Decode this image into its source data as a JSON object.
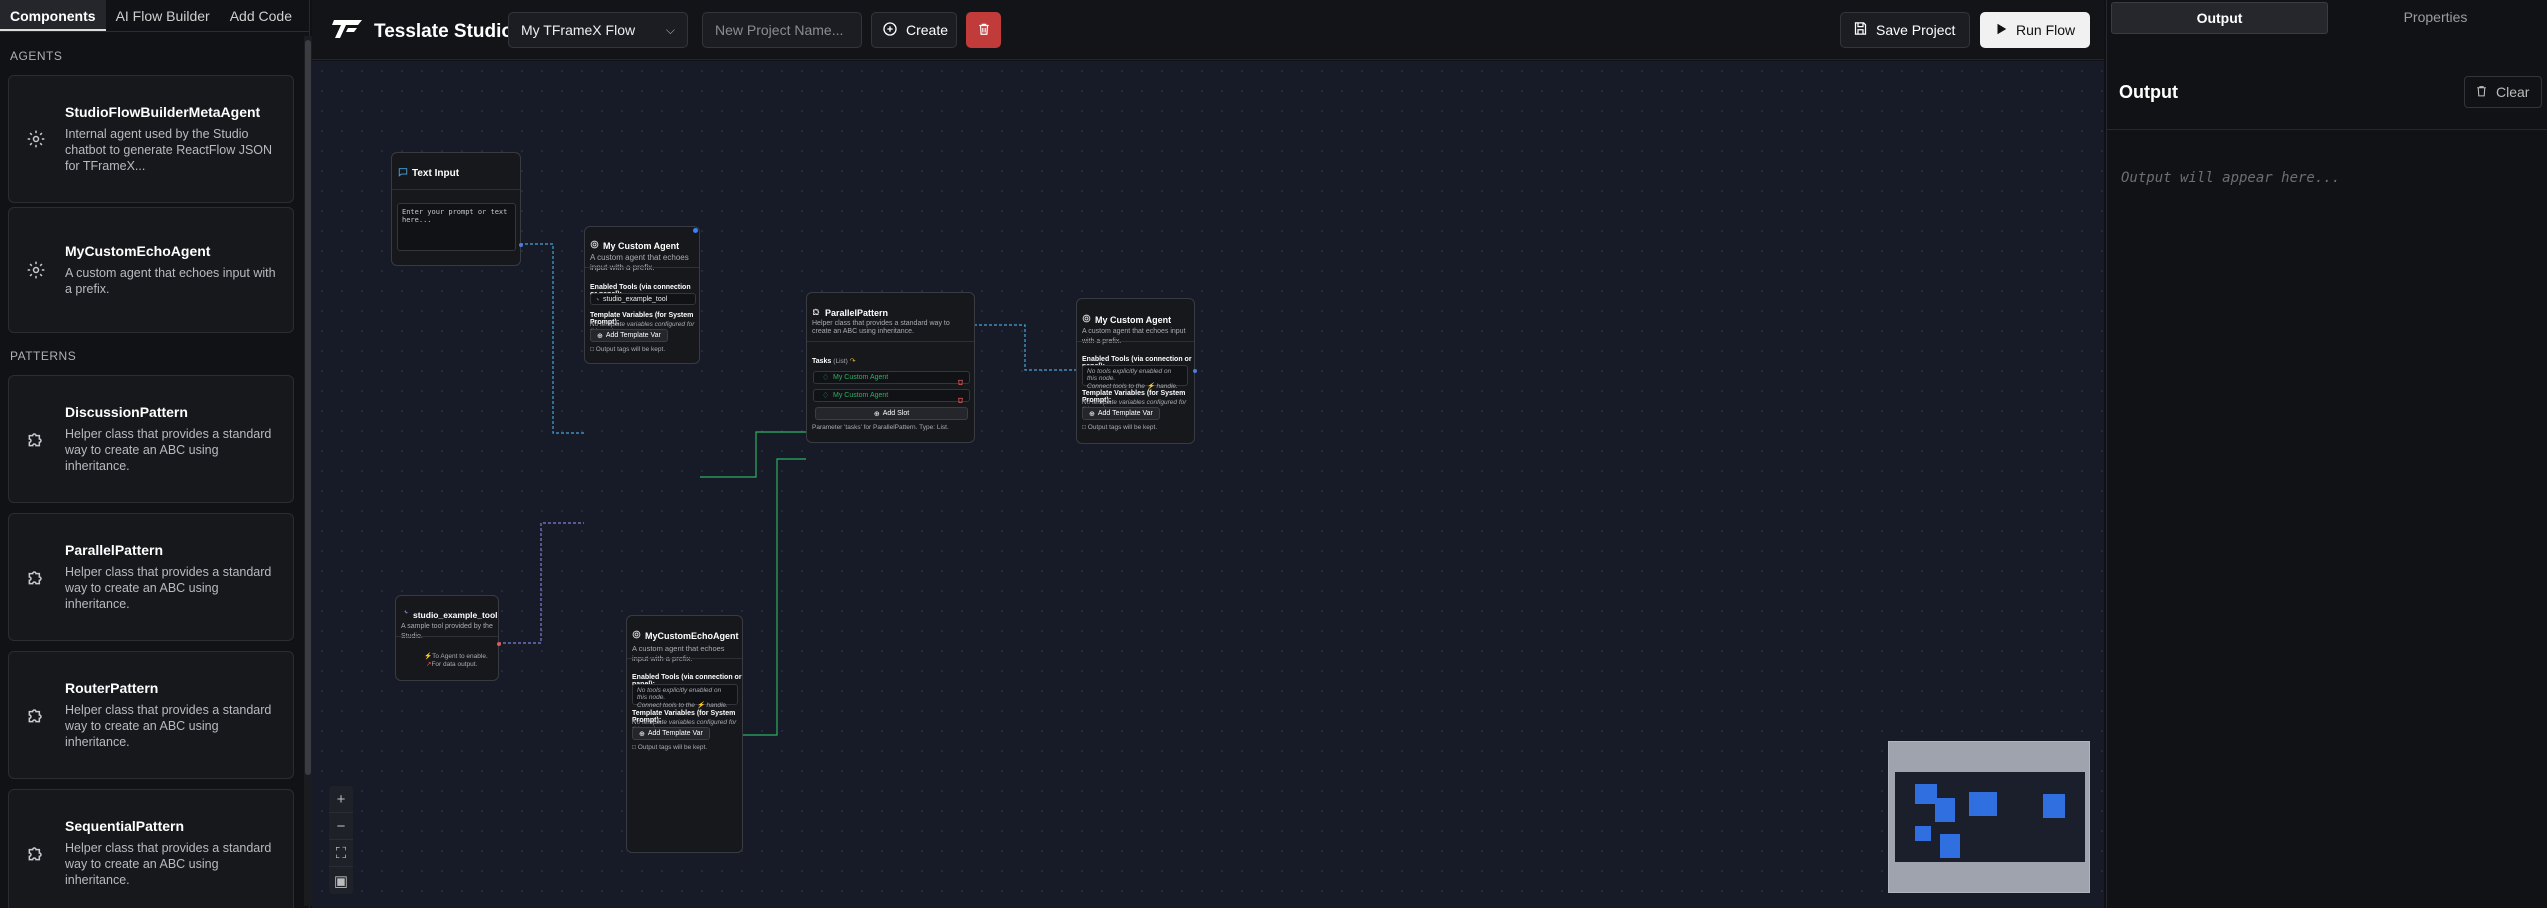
{
  "sidebar": {
    "tabs": [
      "Components",
      "AI Flow Builder",
      "Add Code"
    ],
    "sections": {
      "agents": "AGENTS",
      "patterns": "PATTERNS"
    },
    "agents": [
      {
        "title": "StudioFlowBuilderMetaAgent",
        "desc": "Internal agent used by the Studio chatbot to generate ReactFlow JSON for TFrameX..."
      },
      {
        "title": "MyCustomEchoAgent",
        "desc": "A custom agent that echoes input with a prefix."
      }
    ],
    "patterns": [
      {
        "title": "DiscussionPattern",
        "desc": "Helper class that provides a standard way to create an ABC using inheritance."
      },
      {
        "title": "ParallelPattern",
        "desc": "Helper class that provides a standard way to create an ABC using inheritance."
      },
      {
        "title": "RouterPattern",
        "desc": "Helper class that provides a standard way to create an ABC using inheritance."
      },
      {
        "title": "SequentialPattern",
        "desc": "Helper class that provides a standard way to create an ABC using inheritance."
      }
    ]
  },
  "topbar": {
    "app_title": "Tesslate Studio",
    "flow_selected": "My TFrameX Flow",
    "project_placeholder": "New Project Name...",
    "create_label": "Create",
    "save_label": "Save Project",
    "run_label": "Run Flow"
  },
  "nodes": {
    "text_input": {
      "title": "Text Input",
      "placeholder": "Enter your prompt or text here..."
    },
    "agent1": {
      "title": "My Custom Agent",
      "desc": "A custom agent that echoes input with a prefix.",
      "tools_label": "Enabled Tools (via connection or panel):",
      "tool": "studio_example_tool",
      "tmpl_label": "Template Variables (for System Prompt):",
      "tmpl_none": "No template variables configured for this node.",
      "add_var": "Add Template Var",
      "output_note": "Output tags will be kept."
    },
    "tool": {
      "title": "studio_example_tool",
      "desc": "A sample tool provided by the Studio.",
      "hint1": "To Agent to enable.",
      "hint2": "For data output."
    },
    "echo": {
      "title": "MyCustomEchoAgent",
      "desc": "A custom agent that echoes input with a prefix.",
      "tools_label": "Enabled Tools (via connection or panel):",
      "no_tools1": "No tools explicitly enabled on this node.",
      "no_tools2": "Connect tools to the ⚡ handle.",
      "tmpl_label": "Template Variables (for System Prompt):",
      "tmpl_none": "No template variables configured for this node.",
      "add_var": "Add Template Var",
      "output_note": "Output tags will be kept."
    },
    "parallel": {
      "title": "ParallelPattern",
      "desc": "Helper class that provides a standard way to create an ABC using inheritance.",
      "tasks_label": "Tasks",
      "tasks_type": "(List)",
      "task1": "My Custom Agent",
      "task2": "My Custom Agent",
      "add_slot": "Add Slot",
      "param_note": "Parameter 'tasks' for ParallelPattern. Type: List."
    },
    "agent2": {
      "title": "My Custom Agent",
      "desc": "A custom agent that echoes input with a prefix.",
      "tools_label": "Enabled Tools (via connection or panel):",
      "no_tools1": "No tools explicitly enabled on this node.",
      "no_tools2": "Connect tools to the ⚡ handle.",
      "tmpl_label": "Template Variables (for System Prompt):",
      "tmpl_none": "No template variables configured for this node.",
      "add_var": "Add Template Var",
      "output_note": "Output tags will be kept."
    }
  },
  "right_panel": {
    "tabs": [
      "Output",
      "Properties"
    ],
    "title": "Output",
    "clear_label": "Clear",
    "placeholder": "Output will appear here..."
  },
  "colors": {
    "accent_blue": "#4d7bd7",
    "edge_green": "#2fae63",
    "delete_red": "#c23b3b",
    "task_green": "#2fae63"
  }
}
